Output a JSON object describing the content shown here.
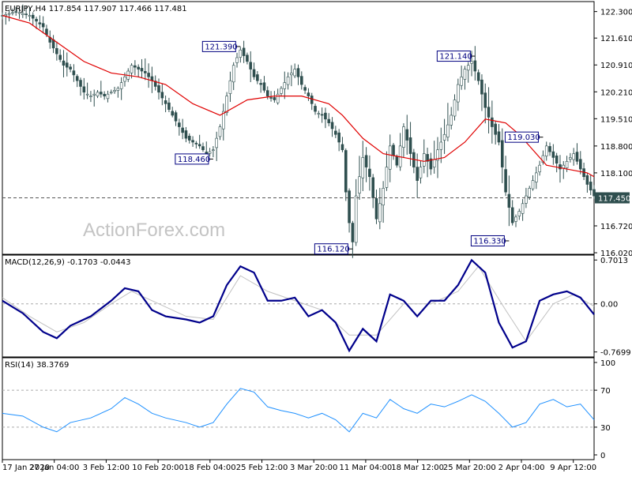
{
  "chart_data": [
    {
      "type": "candlestick",
      "header": "EURJPY,H4  117.854 117.907 117.466 117.481",
      "price_axis_labels": [
        "122.300",
        "121.610",
        "120.910",
        "120.210",
        "119.510",
        "118.800",
        "118.100",
        "117.450",
        "116.720",
        "116.020"
      ],
      "ylim": [
        115.98,
        122.56
      ],
      "current_price": 117.45,
      "current_price_label": "117.450",
      "time_labels": [
        "17 Jan 2020",
        "27 Jan 04:00",
        "3 Feb 12:00",
        "10 Feb 20:00",
        "18 Feb 04:00",
        "25 Feb 12:00",
        "3 Mar 20:00",
        "11 Mar 04:00",
        "18 Mar 12:00",
        "25 Mar 20:00",
        "2 Apr 04:00",
        "9 Apr 12:00"
      ],
      "close_path": [
        [
          0,
          122.2
        ],
        [
          4,
          122.3
        ],
        [
          8,
          122.2
        ],
        [
          12,
          121.9
        ],
        [
          14,
          121.5
        ],
        [
          16,
          121.2
        ],
        [
          18,
          120.9
        ],
        [
          20,
          120.8
        ],
        [
          22,
          120.5
        ],
        [
          24,
          120.2
        ],
        [
          26,
          120.1
        ],
        [
          28,
          120.2
        ],
        [
          30,
          120.1
        ],
        [
          32,
          120.2
        ],
        [
          34,
          120.3
        ],
        [
          36,
          120.6
        ],
        [
          38,
          120.9
        ],
        [
          40,
          120.8
        ],
        [
          42,
          120.7
        ],
        [
          44,
          120.5
        ],
        [
          46,
          120.2
        ],
        [
          48,
          119.9
        ],
        [
          50,
          119.6
        ],
        [
          52,
          119.3
        ],
        [
          54,
          119.0
        ],
        [
          56,
          118.9
        ],
        [
          58,
          118.8
        ],
        [
          60,
          118.6
        ],
        [
          62,
          118.7
        ],
        [
          64,
          119.3
        ],
        [
          66,
          120.1
        ],
        [
          68,
          120.9
        ],
        [
          70,
          121.3
        ],
        [
          72,
          121.0
        ],
        [
          74,
          120.6
        ],
        [
          76,
          120.4
        ],
        [
          78,
          120.1
        ],
        [
          80,
          120.0
        ],
        [
          82,
          120.3
        ],
        [
          84,
          120.6
        ],
        [
          86,
          120.8
        ],
        [
          88,
          120.4
        ],
        [
          90,
          120.1
        ],
        [
          92,
          119.7
        ],
        [
          94,
          119.6
        ],
        [
          96,
          119.4
        ],
        [
          98,
          119.1
        ],
        [
          100,
          118.7
        ],
        [
          101,
          117.6
        ],
        [
          102,
          116.8
        ],
        [
          103,
          116.3
        ],
        [
          104,
          117.5
        ],
        [
          106,
          118.5
        ],
        [
          108,
          118.0
        ],
        [
          110,
          116.9
        ],
        [
          112,
          117.7
        ],
        [
          114,
          118.8
        ],
        [
          116,
          118.3
        ],
        [
          118,
          119.3
        ],
        [
          120,
          118.6
        ],
        [
          122,
          117.9
        ],
        [
          124,
          118.6
        ],
        [
          126,
          118.2
        ],
        [
          128,
          118.7
        ],
        [
          130,
          119.1
        ],
        [
          132,
          119.6
        ],
        [
          134,
          120.4
        ],
        [
          136,
          120.8
        ],
        [
          138,
          121.0
        ],
        [
          140,
          120.5
        ],
        [
          142,
          119.8
        ],
        [
          144,
          119.3
        ],
        [
          146,
          118.9
        ],
        [
          148,
          117.6
        ],
        [
          150,
          116.8
        ],
        [
          152,
          117.1
        ],
        [
          154,
          117.5
        ],
        [
          156,
          117.9
        ],
        [
          158,
          118.3
        ],
        [
          160,
          118.8
        ],
        [
          162,
          118.5
        ],
        [
          164,
          118.2
        ],
        [
          166,
          118.4
        ],
        [
          168,
          118.6
        ],
        [
          170,
          118.2
        ],
        [
          172,
          117.8
        ],
        [
          174,
          117.5
        ]
      ],
      "highs": [
        [
          4,
          122.4
        ],
        [
          70,
          121.4
        ],
        [
          139,
          121.2
        ],
        [
          159,
          119.1
        ],
        [
          135,
          121.2
        ]
      ],
      "lows": [
        [
          62,
          118.4
        ],
        [
          103,
          116.1
        ],
        [
          149,
          116.3
        ],
        [
          174,
          117.3
        ]
      ],
      "moving_average": [
        [
          0,
          122.2
        ],
        [
          8,
          122.0
        ],
        [
          16,
          121.5
        ],
        [
          24,
          121.0
        ],
        [
          32,
          120.7
        ],
        [
          40,
          120.6
        ],
        [
          48,
          120.4
        ],
        [
          56,
          119.9
        ],
        [
          64,
          119.6
        ],
        [
          72,
          120.0
        ],
        [
          80,
          120.1
        ],
        [
          88,
          120.1
        ],
        [
          96,
          119.9
        ],
        [
          100,
          119.6
        ],
        [
          106,
          119.0
        ],
        [
          112,
          118.6
        ],
        [
          118,
          118.5
        ],
        [
          124,
          118.4
        ],
        [
          130,
          118.5
        ],
        [
          136,
          118.9
        ],
        [
          142,
          119.5
        ],
        [
          148,
          119.4
        ],
        [
          152,
          119.1
        ],
        [
          156,
          118.7
        ],
        [
          160,
          118.3
        ],
        [
          166,
          118.2
        ],
        [
          172,
          118.1
        ],
        [
          174,
          118.0
        ]
      ],
      "annotations": [
        {
          "label": "121.390",
          "x": 70,
          "y": 121.39
        },
        {
          "label": "118.460",
          "x": 62,
          "y": 118.46
        },
        {
          "label": "116.120",
          "x": 103,
          "y": 116.12
        },
        {
          "label": "121.140",
          "x": 139,
          "y": 121.14
        },
        {
          "label": "119.030",
          "x": 159,
          "y": 119.03
        },
        {
          "label": "116.330",
          "x": 149,
          "y": 116.33
        }
      ],
      "watermark": "ActionForex.com"
    },
    {
      "type": "line",
      "title": "MACD(12,26,9) -0.1703 -0.0443",
      "axis_labels": [
        "0.7013",
        "0.00",
        "-0.7699"
      ],
      "ylim": [
        -0.85,
        0.78
      ],
      "series": [
        {
          "name": "MACD",
          "color": "#00008b",
          "values": [
            [
              0,
              0.05
            ],
            [
              6,
              -0.15
            ],
            [
              12,
              -0.45
            ],
            [
              16,
              -0.55
            ],
            [
              20,
              -0.35
            ],
            [
              26,
              -0.2
            ],
            [
              32,
              0.05
            ],
            [
              36,
              0.25
            ],
            [
              40,
              0.2
            ],
            [
              44,
              -0.1
            ],
            [
              48,
              -0.2
            ],
            [
              54,
              -0.25
            ],
            [
              58,
              -0.3
            ],
            [
              62,
              -0.2
            ],
            [
              66,
              0.3
            ],
            [
              70,
              0.6
            ],
            [
              74,
              0.5
            ],
            [
              78,
              0.05
            ],
            [
              82,
              0.05
            ],
            [
              86,
              0.1
            ],
            [
              90,
              -0.2
            ],
            [
              94,
              -0.1
            ],
            [
              98,
              -0.3
            ],
            [
              102,
              -0.75
            ],
            [
              106,
              -0.4
            ],
            [
              110,
              -0.6
            ],
            [
              114,
              0.15
            ],
            [
              118,
              0.05
            ],
            [
              122,
              -0.2
            ],
            [
              126,
              0.05
            ],
            [
              130,
              0.05
            ],
            [
              134,
              0.3
            ],
            [
              138,
              0.7
            ],
            [
              142,
              0.5
            ],
            [
              146,
              -0.3
            ],
            [
              150,
              -0.7
            ],
            [
              154,
              -0.6
            ],
            [
              158,
              0.05
            ],
            [
              162,
              0.15
            ],
            [
              166,
              0.2
            ],
            [
              170,
              0.1
            ],
            [
              174,
              -0.17
            ]
          ]
        },
        {
          "name": "Signal",
          "color": "#c0c0c0",
          "values": [
            [
              0,
              0.1
            ],
            [
              8,
              -0.2
            ],
            [
              16,
              -0.45
            ],
            [
              24,
              -0.3
            ],
            [
              32,
              0.0
            ],
            [
              38,
              0.2
            ],
            [
              46,
              0.0
            ],
            [
              54,
              -0.2
            ],
            [
              62,
              -0.25
            ],
            [
              70,
              0.45
            ],
            [
              78,
              0.2
            ],
            [
              86,
              0.05
            ],
            [
              94,
              -0.1
            ],
            [
              102,
              -0.5
            ],
            [
              110,
              -0.5
            ],
            [
              118,
              0.0
            ],
            [
              126,
              0.0
            ],
            [
              134,
              0.2
            ],
            [
              140,
              0.6
            ],
            [
              148,
              -0.1
            ],
            [
              154,
              -0.6
            ],
            [
              162,
              0.0
            ],
            [
              168,
              0.15
            ],
            [
              174,
              -0.04
            ]
          ]
        }
      ]
    },
    {
      "type": "line",
      "title": "RSI(14) 38.3769",
      "axis_labels": [
        "100",
        "70",
        "30",
        "0"
      ],
      "ylim": [
        0,
        100
      ],
      "levels": [
        70,
        30
      ],
      "series": [
        {
          "name": "RSI",
          "color": "#1e90ff",
          "values": [
            [
              0,
              45
            ],
            [
              6,
              42
            ],
            [
              12,
              30
            ],
            [
              16,
              25
            ],
            [
              20,
              35
            ],
            [
              26,
              40
            ],
            [
              32,
              50
            ],
            [
              36,
              62
            ],
            [
              40,
              55
            ],
            [
              44,
              45
            ],
            [
              48,
              40
            ],
            [
              54,
              35
            ],
            [
              58,
              30
            ],
            [
              62,
              35
            ],
            [
              66,
              55
            ],
            [
              70,
              72
            ],
            [
              74,
              68
            ],
            [
              78,
              52
            ],
            [
              82,
              48
            ],
            [
              86,
              45
            ],
            [
              90,
              40
            ],
            [
              94,
              45
            ],
            [
              98,
              38
            ],
            [
              102,
              25
            ],
            [
              106,
              45
            ],
            [
              110,
              40
            ],
            [
              114,
              60
            ],
            [
              118,
              50
            ],
            [
              122,
              45
            ],
            [
              126,
              55
            ],
            [
              130,
              52
            ],
            [
              134,
              58
            ],
            [
              138,
              65
            ],
            [
              142,
              58
            ],
            [
              146,
              45
            ],
            [
              150,
              30
            ],
            [
              154,
              35
            ],
            [
              158,
              55
            ],
            [
              162,
              60
            ],
            [
              166,
              52
            ],
            [
              170,
              55
            ],
            [
              174,
              38
            ]
          ]
        }
      ]
    }
  ]
}
